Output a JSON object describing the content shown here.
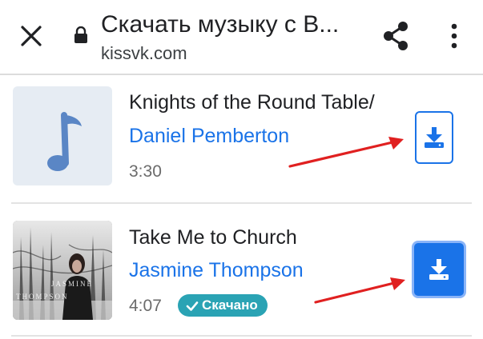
{
  "header": {
    "title": "Скачать музыку с В...",
    "domain": "kissvk.com",
    "icons": [
      "close-icon",
      "lock-icon",
      "share-icon",
      "more-vert-icon"
    ]
  },
  "tracks": [
    {
      "title": "Knights of the Round Table/",
      "artist": "Daniel Pemberton",
      "duration": "3:30",
      "cover": "music-note-icon",
      "download_state": "outline"
    },
    {
      "title": "Take Me to Church",
      "artist": "Jasmine Thompson",
      "duration": "4:07",
      "cover": "album-photo",
      "cover_text": [
        "JASMINE",
        "THOMPSON"
      ],
      "badge": "Скачано",
      "download_state": "filled"
    }
  ],
  "colors": {
    "accent": "#1a73e8",
    "badge": "#2aa3b4",
    "annotation_arrow": "#e02020"
  }
}
